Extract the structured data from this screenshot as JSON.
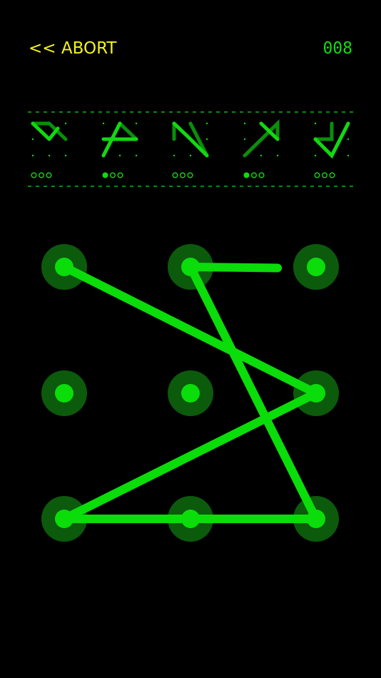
{
  "header": {
    "abort_label": "<< ABORT",
    "counter": "008"
  },
  "colors": {
    "background": "#000000",
    "accent_yellow": "#f2f21a",
    "accent_green": "#12d812",
    "line_green": "#0add0a",
    "dim_green": "#0c5a0c",
    "glyph_dark": "#0a8f0a"
  },
  "sequence": {
    "glyphs": [
      {
        "lit_dots": 0
      },
      {
        "lit_dots": 1
      },
      {
        "lit_dots": 0
      },
      {
        "lit_dots": 1
      },
      {
        "lit_dots": 0
      }
    ],
    "dots_per_glyph": 3
  },
  "pattern_grid": {
    "rows": 3,
    "cols": 3,
    "path_nodes": [
      1,
      8,
      6,
      5,
      0
    ],
    "dragging_toward": "right"
  }
}
